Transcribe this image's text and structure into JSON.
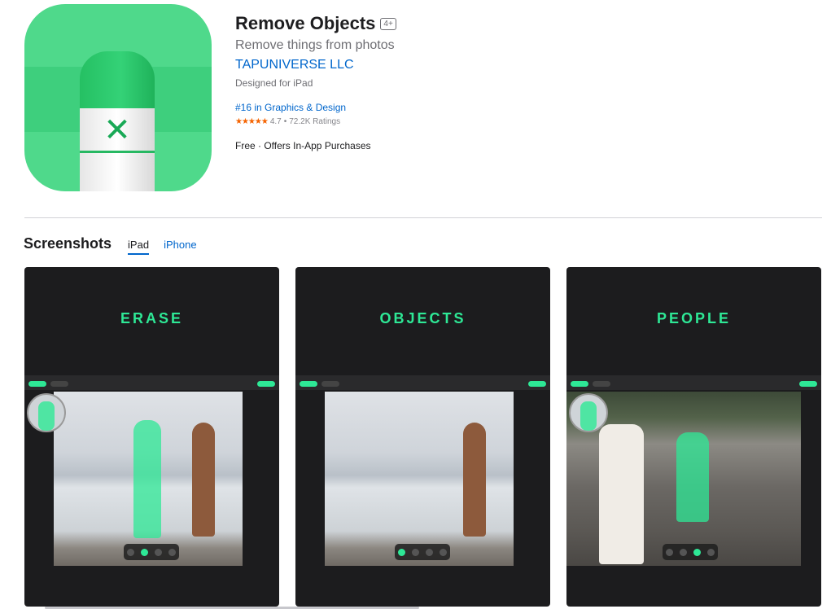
{
  "app": {
    "title": "Remove Objects",
    "age_rating": "4+",
    "subtitle": "Remove things from photos",
    "developer": "TAPUNIVERSE LLC",
    "designed_for": "Designed for iPad",
    "rank": "#16 in Graphics & Design",
    "stars": "★★★★★",
    "rating_value": "4.7",
    "rating_sep": "•",
    "rating_count": "72.2K Ratings",
    "price": "Free · Offers In-App Purchases",
    "icon_glyph": "✕"
  },
  "screenshots": {
    "title": "Screenshots",
    "tabs": [
      {
        "label": "iPad",
        "active": true
      },
      {
        "label": "iPhone",
        "active": false
      }
    ],
    "items": [
      {
        "caption": "ERASE"
      },
      {
        "caption": "OBJECTS"
      },
      {
        "caption": "PEOPLE"
      }
    ]
  },
  "colors": {
    "accent": "#0066cc",
    "brand_green": "#2ee896",
    "icon_bg": "#4fd98b",
    "star": "#f56300"
  }
}
